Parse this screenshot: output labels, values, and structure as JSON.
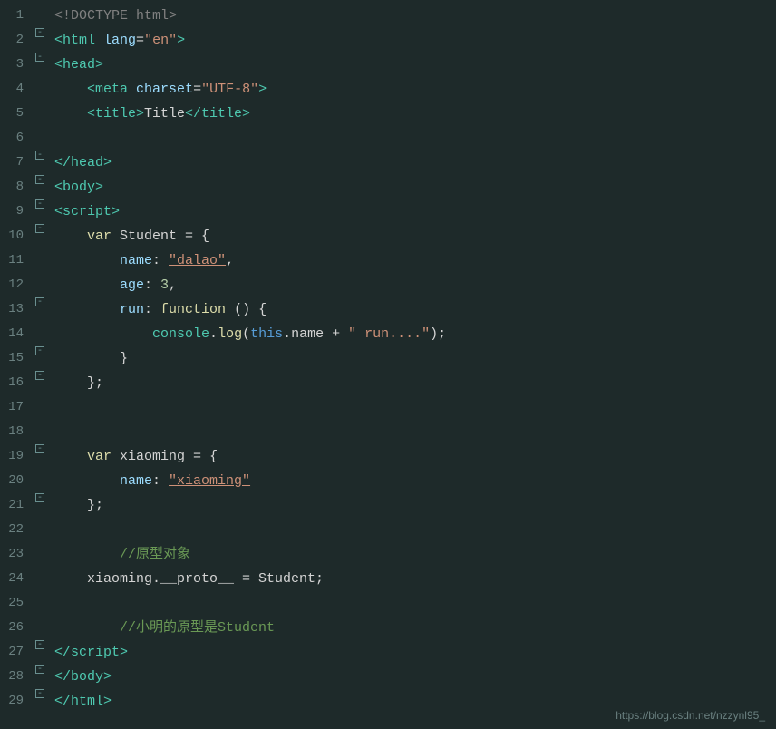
{
  "watermark": "https://blog.csdn.net/nzzynl95_",
  "lines": [
    {
      "num": 1,
      "fold": false,
      "html": "<span class='c-tag-bracket'>&lt;!DOCTYPE html&gt;</span>"
    },
    {
      "num": 2,
      "fold": true,
      "html": "<span class='c-tag'>&lt;html</span> <span class='c-attr'>lang</span><span class='c-eq'>=</span><span class='c-str'>\"en\"</span><span class='c-tag'>&gt;</span>"
    },
    {
      "num": 3,
      "fold": true,
      "html": "<span class='c-tag'>&lt;head&gt;</span>"
    },
    {
      "num": 4,
      "fold": false,
      "html": "    <span class='c-tag'>&lt;meta</span> <span class='c-attr'>charset</span><span class='c-eq'>=</span><span class='c-str'>\"UTF-8\"</span><span class='c-tag'>&gt;</span>"
    },
    {
      "num": 5,
      "fold": false,
      "html": "    <span class='c-tag'>&lt;title&gt;</span><span class='c-white'>Title</span><span class='c-tag'>&lt;/title&gt;</span>"
    },
    {
      "num": 6,
      "fold": false,
      "html": ""
    },
    {
      "num": 7,
      "fold": true,
      "html": "<span class='c-tag'>&lt;/head&gt;</span>"
    },
    {
      "num": 8,
      "fold": true,
      "html": "<span class='c-tag'>&lt;body&gt;</span>"
    },
    {
      "num": 9,
      "fold": true,
      "html": "<span class='c-tag'>&lt;script&gt;</span>"
    },
    {
      "num": 10,
      "fold": true,
      "html": "    <span class='c-kw'>var</span> <span class='c-white'>Student = {</span>"
    },
    {
      "num": 11,
      "fold": false,
      "html": "        <span class='c-prop'>name</span><span class='c-white'>: </span><span class='c-str-u'>\"dalao\"</span><span class='c-white'>,</span>"
    },
    {
      "num": 12,
      "fold": false,
      "html": "        <span class='c-prop'>age</span><span class='c-white'>: </span><span class='c-num'>3</span><span class='c-white'>,</span>"
    },
    {
      "num": 13,
      "fold": true,
      "html": "        <span class='c-prop'>run</span><span class='c-white'>: </span><span class='c-func'>function</span><span class='c-white'> () {</span>"
    },
    {
      "num": 14,
      "fold": false,
      "html": "            <span class='c-builtin'>console</span><span class='c-white'>.</span><span class='c-method'>log</span><span class='c-white'>(</span><span class='c-this'>this</span><span class='c-white'>.name + </span><span class='c-str'>\" run....\"</span><span class='c-white'>);</span>"
    },
    {
      "num": 15,
      "fold": true,
      "html": "        <span class='c-white'>}</span>"
    },
    {
      "num": 16,
      "fold": true,
      "html": "    <span class='c-white'>};</span>"
    },
    {
      "num": 17,
      "fold": false,
      "html": ""
    },
    {
      "num": 18,
      "fold": false,
      "html": ""
    },
    {
      "num": 19,
      "fold": true,
      "html": "    <span class='c-kw'>var</span> <span class='c-white'>xiaoming = {</span>"
    },
    {
      "num": 20,
      "fold": false,
      "html": "        <span class='c-prop'>name</span><span class='c-white'>: </span><span class='c-str-u'>\"xiaoming\"</span>"
    },
    {
      "num": 21,
      "fold": true,
      "html": "    <span class='c-white'>};</span>"
    },
    {
      "num": 22,
      "fold": false,
      "html": ""
    },
    {
      "num": 23,
      "fold": false,
      "html": "        <span class='c-comment'>//原型对象</span>"
    },
    {
      "num": 24,
      "fold": false,
      "html": "    <span class='c-white'>xiaoming.__proto__ = Student;</span>"
    },
    {
      "num": 25,
      "fold": false,
      "html": ""
    },
    {
      "num": 26,
      "fold": false,
      "html": "        <span class='c-comment'>//小明的原型是Student</span>"
    },
    {
      "num": 27,
      "fold": true,
      "html": "<span class='c-tag'>&lt;/script&gt;</span>"
    },
    {
      "num": 28,
      "fold": true,
      "html": "<span class='c-tag'>&lt;/body&gt;</span>"
    },
    {
      "num": 29,
      "fold": true,
      "html": "<span class='c-tag'>&lt;/html&gt;</span>"
    }
  ]
}
